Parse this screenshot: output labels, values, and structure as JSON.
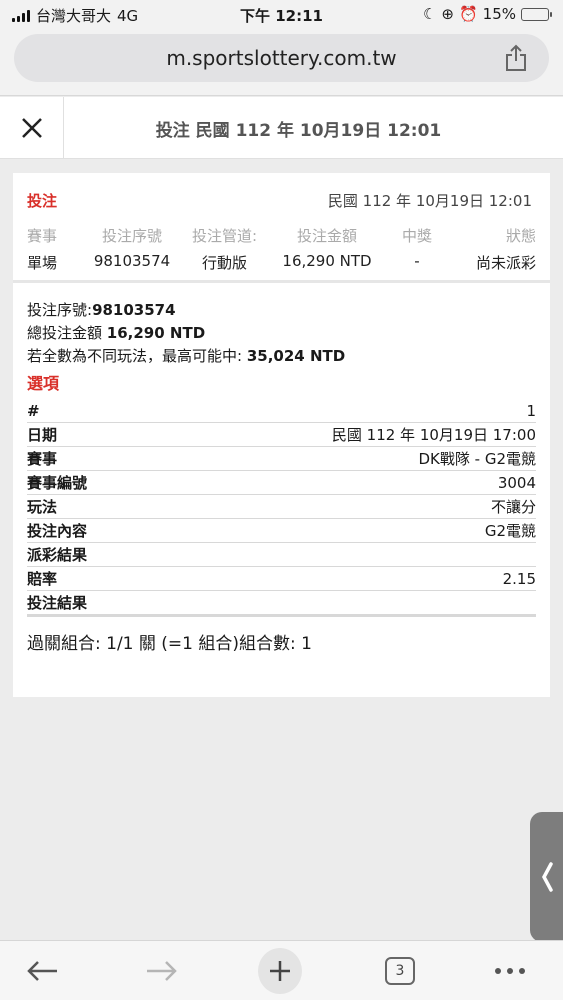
{
  "status_bar": {
    "carrier": "台灣大哥大",
    "network": "4G",
    "time": "下午 12:11",
    "battery": "15%",
    "battery_level": 0.15
  },
  "browser": {
    "url": "m.sportslottery.com.tw",
    "open_tabs": "3"
  },
  "header": {
    "title": "投注 民國 112 年 10月19日 12:01"
  },
  "summary": {
    "label": "投注",
    "date": "民國 112 年 10月19日 12:01",
    "columns": [
      "賽事",
      "投注序號",
      "投注管道:",
      "投注金額",
      "中獎",
      "狀態"
    ],
    "values": [
      "單場",
      "98103574",
      "行動版",
      "16,290 NTD",
      "-",
      "尚未派彩"
    ]
  },
  "detail": {
    "serial_label": "投注序號:",
    "serial_value": "98103574",
    "total_label": "總投注金額",
    "total_value": "16,290 NTD",
    "max_label": "若全數為不同玩法，最高可能中:",
    "max_value": "35,024 NTD",
    "options_title": "選項",
    "rows": [
      {
        "key": "#",
        "value": "1"
      },
      {
        "key": "日期",
        "value": "民國 112 年 10月19日 17:00"
      },
      {
        "key": "賽事",
        "value": "DK戰隊 - G2電競"
      },
      {
        "key": "賽事編號",
        "value": "3004"
      },
      {
        "key": "玩法",
        "value": "不讓分"
      },
      {
        "key": "投注內容",
        "value": "G2電競"
      },
      {
        "key": "派彩結果",
        "value": ""
      },
      {
        "key": "賠率",
        "value": "2.15"
      },
      {
        "key": "投注結果",
        "value": ""
      }
    ],
    "combination": "過關組合: 1/1 關 (=1 組合)組合數: 1"
  }
}
